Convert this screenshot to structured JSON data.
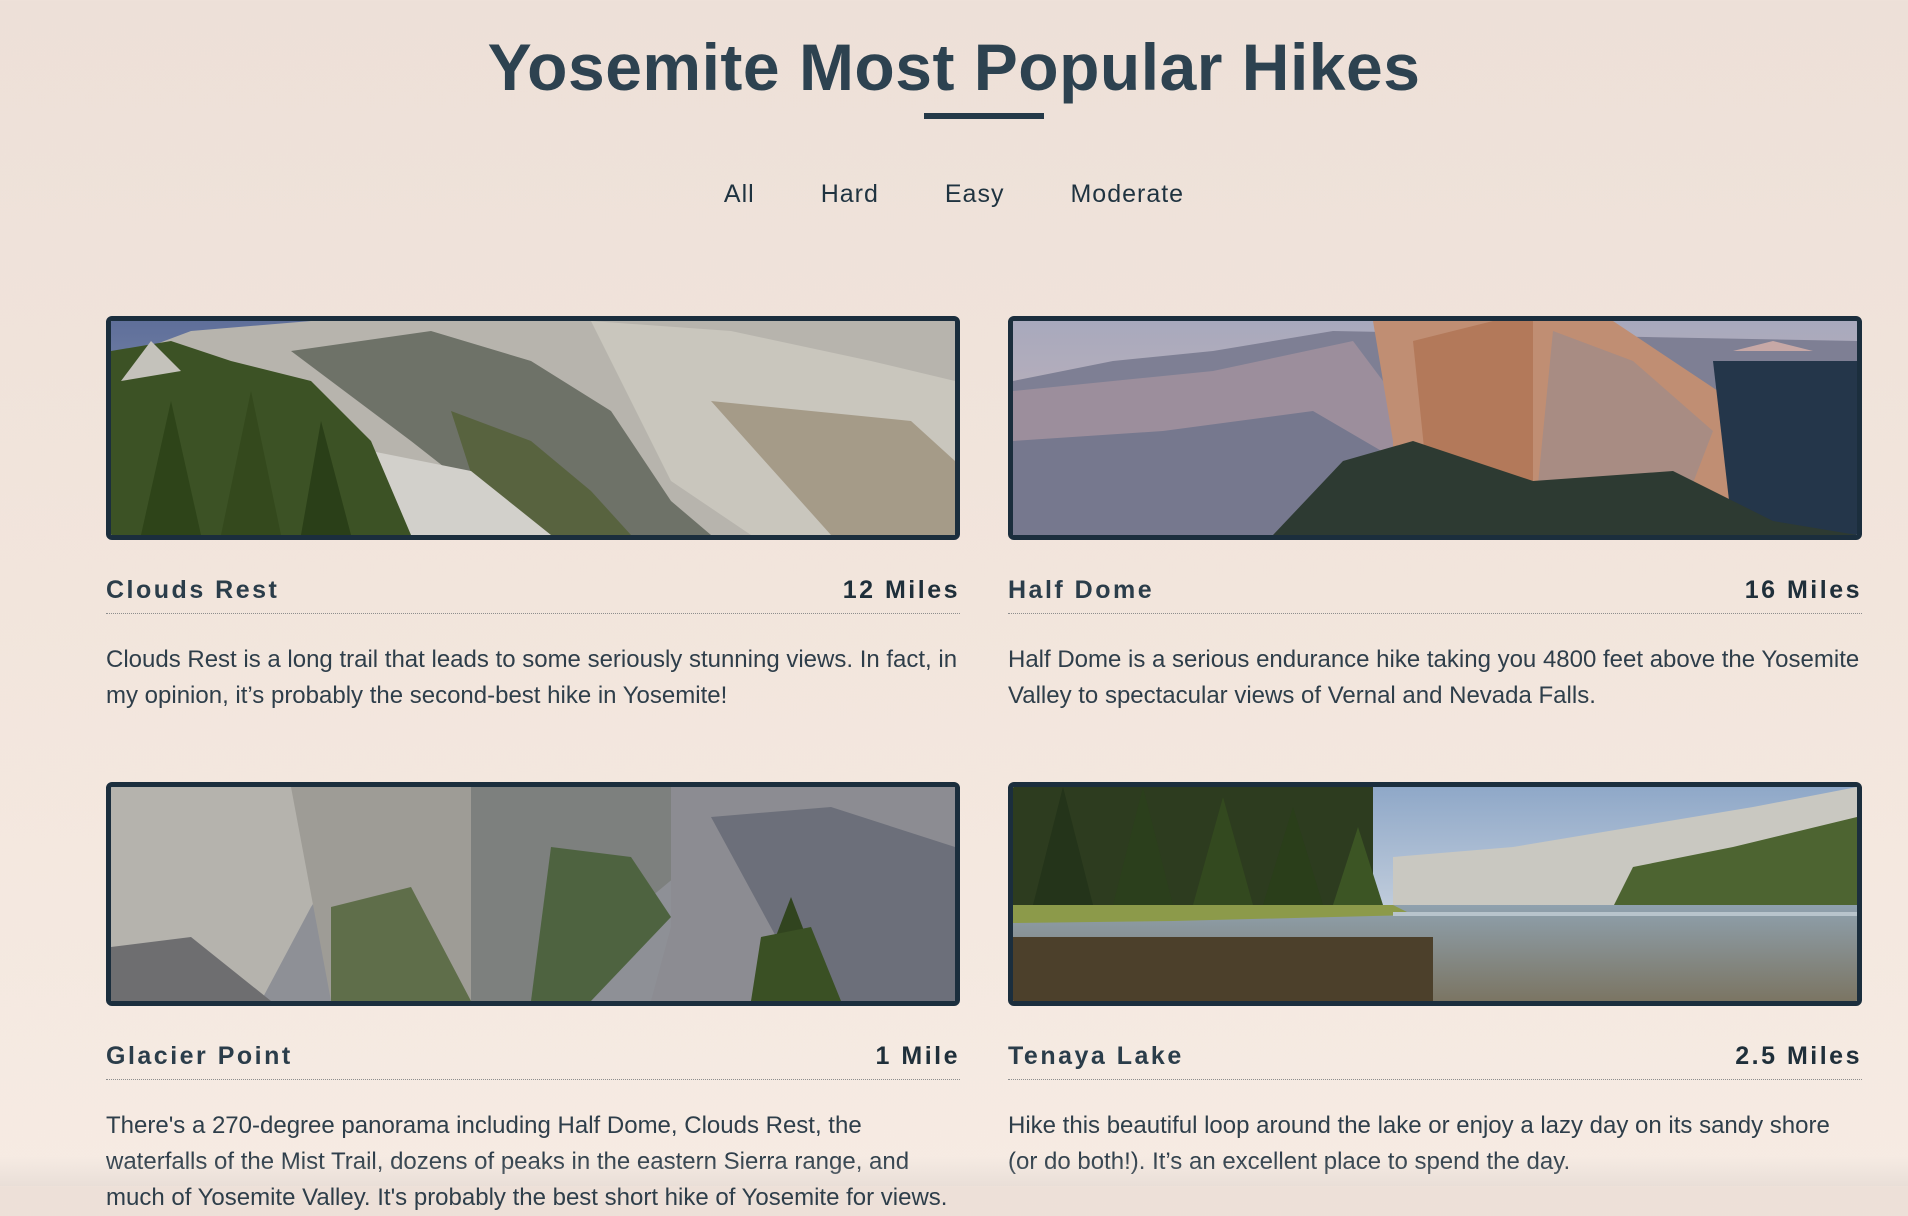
{
  "header": {
    "title": "Yosemite Most Popular Hikes"
  },
  "filters": [
    "All",
    "Hard",
    "Easy",
    "Moderate"
  ],
  "hikes": [
    {
      "name": "Clouds Rest",
      "distance": "12 Miles",
      "description": "Clouds Rest is a long trail that leads to some seriously stunning views. In fact, in my opinion, it’s probably the second-best hike in Yosemite!"
    },
    {
      "name": "Half Dome",
      "distance": "16 Miles",
      "description": "Half Dome is a serious endurance hike taking you 4800 feet above the Yosemite Valley to spectacular views of Vernal and Nevada Falls."
    },
    {
      "name": "Glacier Point",
      "distance": "1 Mile",
      "description": "There's a 270-degree panorama including Half Dome, Clouds Rest, the waterfalls of the Mist Trail, dozens of peaks in the eastern Sierra range, and much of Yosemite Valley. It's probably the best short hike of Yosemite for views."
    },
    {
      "name": "Tenaya Lake",
      "distance": "2.5 Miles",
      "description": "Hike this beautiful loop around the lake or enjoy a lazy day on its sandy shore (or do both!). It’s an excellent place to spend the day."
    }
  ],
  "colors": {
    "background": "#efe3da",
    "title": "#2d4250",
    "card_border": "#1b2e3d",
    "text": "#2e3e4a"
  }
}
